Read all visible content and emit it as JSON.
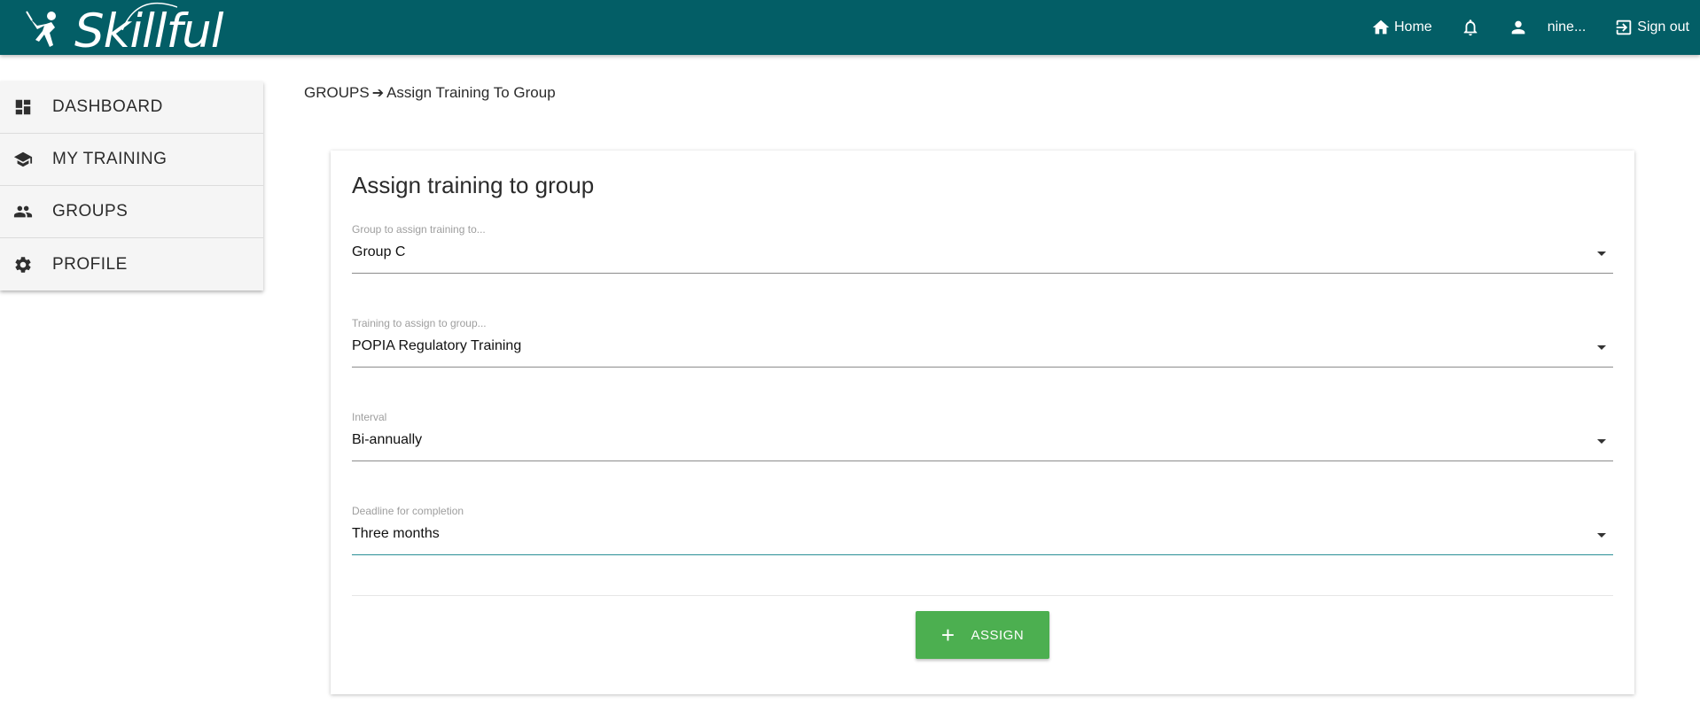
{
  "brand": {
    "name": "Skillful"
  },
  "topnav": {
    "home_label": "Home",
    "user_label": "nine...",
    "signout_label": "Sign out"
  },
  "sidebar": {
    "items": [
      {
        "label": "DASHBOARD",
        "icon": "dashboard-icon"
      },
      {
        "label": "MY TRAINING",
        "icon": "graduation-cap-icon"
      },
      {
        "label": "GROUPS",
        "icon": "people-icon"
      },
      {
        "label": "PROFILE",
        "icon": "gear-icon"
      }
    ]
  },
  "breadcrumb": {
    "parent": "GROUPS",
    "separator": "➔",
    "current": "Assign Training To Group"
  },
  "form": {
    "title": "Assign training to group",
    "fields": [
      {
        "label": "Group to assign training to...",
        "value": "Group C"
      },
      {
        "label": "Training to assign to group...",
        "value": "POPIA Regulatory Training"
      },
      {
        "label": "Interval",
        "value": "Bi-annually"
      },
      {
        "label": "Deadline for completion",
        "value": "Three months"
      }
    ],
    "submit_label": "ASSIGN",
    "submit_icon": "+"
  },
  "colors": {
    "topbar": "#035e66",
    "assign_button": "#4caf50",
    "active_underline": "#2a8f97"
  }
}
